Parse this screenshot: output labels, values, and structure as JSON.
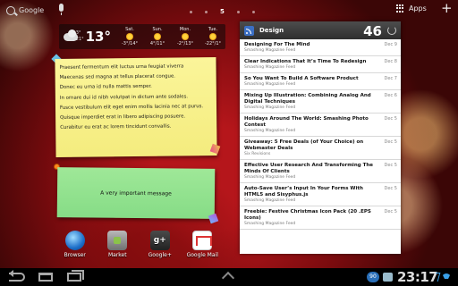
{
  "topbar": {
    "search_label": "Google",
    "apps_label": "Apps",
    "current_page": "5",
    "add_label": "+"
  },
  "weather": {
    "hilo_top": "-3°",
    "hilo_bottom": "-21°",
    "current_temp": "13°",
    "forecast": [
      {
        "day": "Sat.",
        "range": "-3°/14°",
        "icon": "sun-icon"
      },
      {
        "day": "Sun.",
        "range": "4°/11°",
        "icon": "sun-icon"
      },
      {
        "day": "Mon.",
        "range": "-2°/13°",
        "icon": "sun-icon"
      },
      {
        "day": "Tue.",
        "range": "-22°/1°",
        "icon": "sun-icon"
      }
    ]
  },
  "note1": {
    "lines": [
      "Praesent fermentum elit luctus urna feugiat viverra",
      "Maecenas sed magna at tellus placerat congue.",
      "Donec eu urna id nulla mattis semper.",
      "In ornare dui id nibh volutpat in dictum ante sodales.",
      "Fusce vestibulum elit eget enim mollis lacinia nec at purus.",
      "Quisque imperdiet erat in libero adipiscing posuere.",
      "Curabitur eu erat ac lorem tincidunt convallis."
    ]
  },
  "note2": {
    "text": "A very important message"
  },
  "feed": {
    "title": "Design",
    "count": "46",
    "items": [
      {
        "title": "Designing For The Mind",
        "source": "Smashing Magazine Feed",
        "date": "Dec 9"
      },
      {
        "title": "Clear Indications That It’s Time To Redesign",
        "source": "Smashing Magazine Feed",
        "date": "Dec 8"
      },
      {
        "title": "So You Want To Build A Software Product",
        "source": "Smashing Magazine Feed",
        "date": "Dec 7"
      },
      {
        "title": "Mixing Up Illustration: Combining Analog And Digital Techniques",
        "source": "Smashing Magazine Feed",
        "date": "Dec 6"
      },
      {
        "title": "Holidays Around The World: Smashing Photo Contest",
        "source": "Smashing Magazine Feed",
        "date": "Dec 5"
      },
      {
        "title": "Giveaway: 5 Free Deals (of Your Choice) on Webmaster Deals",
        "source": "Six Revisions",
        "date": "Dec 5"
      },
      {
        "title": "Effective User Research And Transforming The Minds Of Clients",
        "source": "Smashing Magazine Feed",
        "date": "Dec 5"
      },
      {
        "title": "Auto-Save User’s Input In Your Forms With HTML5 and Sisyphus.js",
        "source": "Smashing Magazine Feed",
        "date": "Dec 5"
      },
      {
        "title": "Freebie: Festive Christmas Icon Pack (20 .EPS Icons)",
        "source": "Smashing Magazine Feed",
        "date": "Dec 5"
      }
    ]
  },
  "dock": [
    {
      "label": "Browser",
      "icon": "browser-icon"
    },
    {
      "label": "Market",
      "icon": "market-icon"
    },
    {
      "label": "Google+",
      "icon": "google-plus-icon",
      "glyph": "g+"
    },
    {
      "label": "Google Mail",
      "icon": "gmail-icon"
    }
  ],
  "sysbar": {
    "clock": "23:17",
    "notification_count": "90"
  }
}
